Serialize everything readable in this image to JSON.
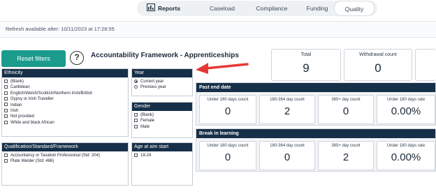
{
  "nav": {
    "items": [
      {
        "label": "Reports"
      },
      {
        "label": "Caseload"
      },
      {
        "label": "Compliance"
      },
      {
        "label": "Funding"
      },
      {
        "label": "Quality"
      }
    ]
  },
  "refresh": {
    "text": "Refresh available after: 10/11/2023 at 17:28:55"
  },
  "reset_label": "Reset filters",
  "help_symbol": "?",
  "page_title": "Accountability Framework - Apprenticeships",
  "filters": {
    "ethnicity": {
      "title": "Ethnicity",
      "options": [
        "(Blank)",
        "Caribbean",
        "English/Welsh/Scottish/Northern Irish/British",
        "Gypsy or Irish Traveller",
        "Indian",
        "Irish",
        "Not provided",
        "White and black African"
      ]
    },
    "year": {
      "title": "Year",
      "options": [
        "Current year",
        "Previous year"
      ],
      "selected": "Current year"
    },
    "gender": {
      "title": "Gender",
      "options": [
        "(Blank)",
        "Female",
        "Male"
      ]
    },
    "qualification": {
      "title": "Qualification/Standard/Framework",
      "options": [
        "Accountancy or Taxation Professional (Std: 204)",
        "Plate Welder (Std: 486)"
      ]
    },
    "age": {
      "title": "Age at aim start",
      "options": [
        "19-24"
      ]
    }
  },
  "kpis": {
    "total": {
      "label": "Total",
      "value": "9"
    },
    "withdrawal": {
      "label": "Withdrawal count",
      "value": "0"
    }
  },
  "past_end": {
    "title": "Past end date",
    "cards": [
      {
        "label": "Under 180 days count",
        "value": "0"
      },
      {
        "label": "180-364 day count",
        "value": "2"
      },
      {
        "label": "365+ day count",
        "value": "0"
      },
      {
        "label": "Under 180 days rate",
        "value": "0.00%"
      }
    ]
  },
  "break_in_learning": {
    "title": "Break in learning",
    "cards": [
      {
        "label": "Under 180 days count",
        "value": "0"
      },
      {
        "label": "180-364 day count",
        "value": "0"
      },
      {
        "label": "365+ day count",
        "value": "2"
      },
      {
        "label": "Under 180 days rate",
        "value": "0.00%"
      }
    ]
  },
  "colors": {
    "accent": "#1a9b8c",
    "header": "#173049",
    "arrow": "#e53935"
  }
}
